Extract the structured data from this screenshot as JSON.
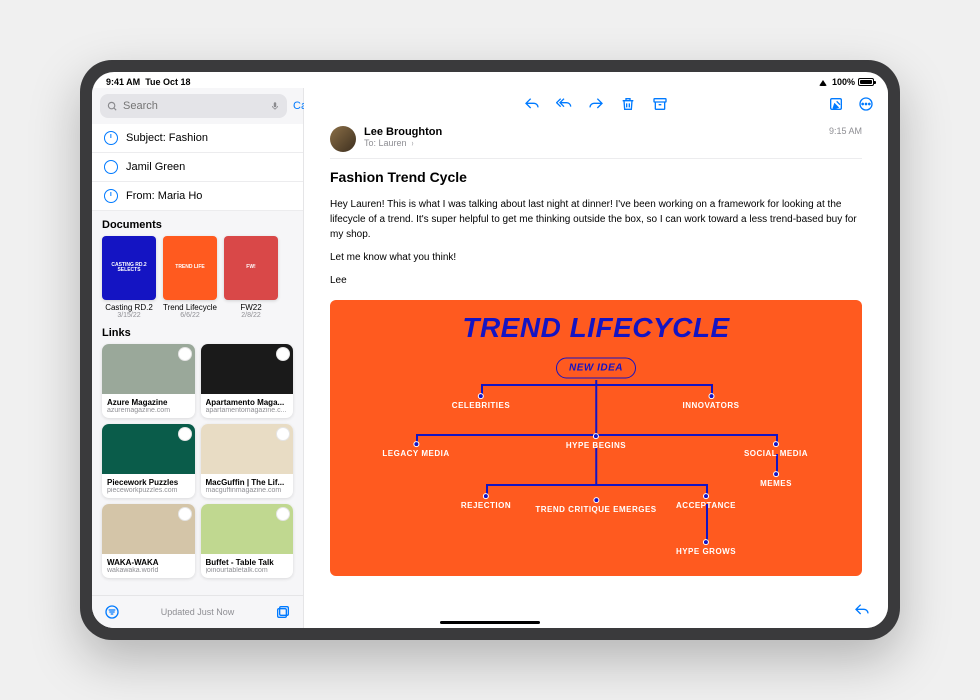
{
  "status": {
    "time": "9:41 AM",
    "date": "Tue Oct 18",
    "battery": "100%"
  },
  "sidebar": {
    "search_placeholder": "Search",
    "cancel": "Cancel",
    "filters": [
      {
        "icon": "clock",
        "label": "Subject: Fashion"
      },
      {
        "icon": "person",
        "label": "Jamil Green"
      },
      {
        "icon": "clock",
        "label": "From: Maria Ho"
      }
    ],
    "documents_title": "Documents",
    "documents": [
      {
        "name": "Casting RD.2",
        "date": "3/15/22",
        "bg": "#1414c3",
        "text": "CASTING RD.2 SELECTS"
      },
      {
        "name": "Trend Lifecycle",
        "date": "6/6/22",
        "bg": "#ff5a1f",
        "text": "TREND LIFE"
      },
      {
        "name": "FW22",
        "date": "2/8/22",
        "bg": "#d94848",
        "text": "FW!"
      }
    ],
    "links_title": "Links",
    "links": [
      {
        "title": "Azure Magazine",
        "domain": "azuremagazine.com",
        "bg": "#9aa89a"
      },
      {
        "title": "Apartamento Maga...",
        "domain": "apartamentomagazine.c...",
        "bg": "#1a1a1a"
      },
      {
        "title": "Piecework Puzzles",
        "domain": "pieceworkpuzzles.com",
        "bg": "#0a5c4a"
      },
      {
        "title": "MacGuffin | The Lif...",
        "domain": "macguffinmagazine.com",
        "bg": "#e8dcc4"
      },
      {
        "title": "WAKA-WAKA",
        "domain": "wakawaka.world",
        "bg": "#d4c5a8"
      },
      {
        "title": "Buffet - Table Talk",
        "domain": "joinourtabletalk.com",
        "bg": "#c0d890"
      }
    ],
    "footer_status": "Updated Just Now"
  },
  "email": {
    "sender": "Lee Broughton",
    "to_label": "To:",
    "to_name": "Lauren",
    "time": "9:15 AM",
    "subject": "Fashion Trend Cycle",
    "body_p1": "Hey Lauren! This is what I was talking about last night at dinner! I've been working on a framework for looking at the lifecycle of a trend. It's super helpful to get me thinking outside the box, so I can work toward a less trend-based buy for my shop.",
    "body_p2": "Let me know what you think!",
    "body_p3": "Lee",
    "attachment_title": "TREND LIFECYCLE",
    "nodes": {
      "new_idea": "NEW IDEA",
      "celebrities": "CELEBRITIES",
      "innovators": "INNOVATORS",
      "legacy": "LEGACY MEDIA",
      "hype_begins": "HYPE BEGINS",
      "social": "SOCIAL MEDIA",
      "memes": "MEMES",
      "rejection": "REJECTION",
      "critique": "TREND CRITIQUE EMERGES",
      "acceptance": "ACCEPTANCE",
      "hype_grows": "HYPE GROWS"
    }
  }
}
